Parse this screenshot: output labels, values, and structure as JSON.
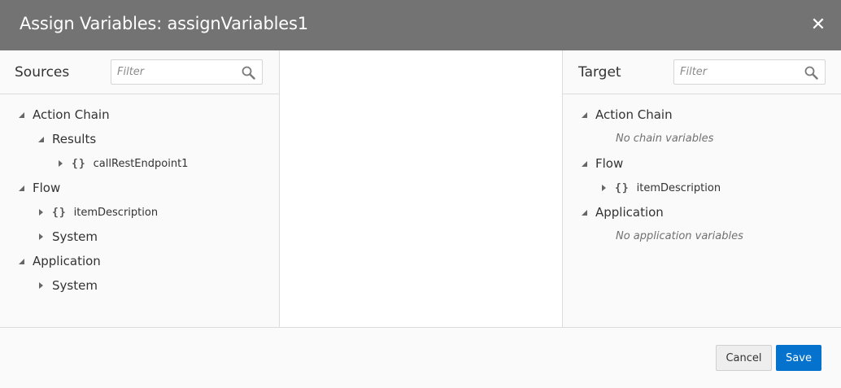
{
  "dialog": {
    "title": "Assign Variables: assignVariables1",
    "close_icon": "close-icon"
  },
  "sources": {
    "title": "Sources",
    "filter_placeholder": "Filter",
    "tree": {
      "action_chain": "Action Chain",
      "results": "Results",
      "call_rest_endpoint": "callRestEndpoint1",
      "flow": "Flow",
      "item_description": "itemDescription",
      "flow_system": "System",
      "application": "Application",
      "app_system": "System"
    }
  },
  "target": {
    "title": "Target",
    "filter_placeholder": "Filter",
    "tree": {
      "action_chain": "Action Chain",
      "no_chain_variables": "No chain variables",
      "flow": "Flow",
      "item_description": "itemDescription",
      "application": "Application",
      "no_application_variables": "No application variables"
    }
  },
  "object_glyph": "{}",
  "footer": {
    "cancel_label": "Cancel",
    "save_label": "Save"
  },
  "colors": {
    "header_bg": "#737373",
    "primary_button": "#0572ce"
  }
}
